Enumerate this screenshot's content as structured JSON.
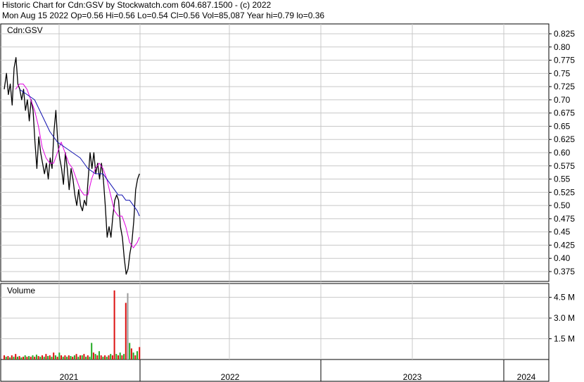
{
  "header": {
    "line1": "Historic Chart for Cdn:GSV by Stockwatch.com 604.687.1500 - (c) 2022",
    "line2": "Mon Aug 15 2022  Op=0.56  Hi=0.56  Lo=0.54  Cl=0.56  Vol=85,087  Year hi=0.79  lo=0.36"
  },
  "colors": {
    "price": "#000000",
    "ma_short": "#e000e0",
    "ma_long": "#1010b0",
    "vol_up": "#22aa22",
    "vol_down": "#dd1111",
    "vol_flat": "#999999",
    "grid": "#c8c8c8"
  },
  "chart_data": [
    {
      "type": "line",
      "title": "Cdn:GSV",
      "x_axis": {
        "labels": [
          "2021",
          "2022",
          "2023",
          "2024"
        ]
      },
      "y_axis": {
        "side": "right",
        "ylim": [
          0.34,
          0.84
        ],
        "ticks": [
          "0.825",
          "0.80",
          "0.775",
          "0.75",
          "0.725",
          "0.70",
          "0.675",
          "0.65",
          "0.625",
          "0.60",
          "0.575",
          "0.55",
          "0.525",
          "0.50",
          "0.475",
          "0.45",
          "0.425",
          "0.40",
          "0.375"
        ]
      },
      "grid": true,
      "series": [
        {
          "values": [
            [
              0.0,
              0.72
            ],
            [
              0.6,
              0.75
            ],
            [
              1.1,
              0.71
            ],
            [
              1.6,
              0.73
            ],
            [
              2.1,
              0.69
            ],
            [
              2.6,
              0.76
            ],
            [
              3.1,
              0.78
            ],
            [
              3.6,
              0.73
            ],
            [
              4.1,
              0.72
            ],
            [
              4.6,
              0.7
            ],
            [
              5.1,
              0.72
            ],
            [
              5.6,
              0.68
            ],
            [
              6.1,
              0.7
            ],
            [
              6.6,
              0.66
            ],
            [
              7.1,
              0.7
            ],
            [
              7.6,
              0.68
            ],
            [
              8.1,
              0.62
            ],
            [
              8.6,
              0.57
            ],
            [
              9.1,
              0.63
            ],
            [
              9.6,
              0.6
            ],
            [
              10.1,
              0.58
            ],
            [
              10.6,
              0.56
            ],
            [
              11.1,
              0.58
            ],
            [
              11.6,
              0.55
            ],
            [
              12.1,
              0.59
            ],
            [
              12.6,
              0.57
            ],
            [
              13.1,
              0.64
            ],
            [
              13.6,
              0.68
            ],
            [
              14.1,
              0.62
            ],
            [
              14.6,
              0.59
            ],
            [
              15.1,
              0.57
            ],
            [
              15.6,
              0.54
            ],
            [
              16.1,
              0.6
            ],
            [
              16.6,
              0.57
            ],
            [
              17.1,
              0.53
            ],
            [
              17.6,
              0.57
            ],
            [
              18.1,
              0.55
            ],
            [
              18.6,
              0.52
            ],
            [
              19.1,
              0.5
            ],
            [
              19.6,
              0.53
            ],
            [
              20.1,
              0.5
            ],
            [
              20.6,
              0.49
            ],
            [
              21.1,
              0.51
            ],
            [
              21.6,
              0.5
            ],
            [
              22.1,
              0.55
            ],
            [
              22.6,
              0.6
            ],
            [
              23.1,
              0.57
            ],
            [
              23.6,
              0.6
            ],
            [
              24.1,
              0.56
            ],
            [
              24.6,
              0.58
            ],
            [
              25.1,
              0.55
            ],
            [
              25.6,
              0.58
            ],
            [
              26.1,
              0.55
            ],
            [
              26.6,
              0.5
            ],
            [
              27.1,
              0.44
            ],
            [
              27.6,
              0.46
            ],
            [
              28.1,
              0.44
            ],
            [
              28.6,
              0.48
            ],
            [
              29.1,
              0.51
            ],
            [
              29.6,
              0.52
            ],
            [
              30.1,
              0.51
            ],
            [
              30.6,
              0.46
            ],
            [
              31.1,
              0.44
            ],
            [
              31.6,
              0.4
            ],
            [
              32.1,
              0.37
            ],
            [
              32.6,
              0.38
            ],
            [
              33.1,
              0.41
            ],
            [
              33.6,
              0.43
            ],
            [
              34.1,
              0.47
            ],
            [
              34.6,
              0.53
            ],
            [
              35.1,
              0.55
            ],
            [
              35.6,
              0.56
            ]
          ]
        },
        {
          "values": [
            [
              3.0,
              0.72
            ],
            [
              4.0,
              0.73
            ],
            [
              5.0,
              0.73
            ],
            [
              6.0,
              0.72
            ],
            [
              7.0,
              0.7
            ],
            [
              8.0,
              0.68
            ],
            [
              9.0,
              0.65
            ],
            [
              10.0,
              0.61
            ],
            [
              11.0,
              0.59
            ],
            [
              12.0,
              0.58
            ],
            [
              13.0,
              0.58
            ],
            [
              14.0,
              0.6
            ],
            [
              15.0,
              0.62
            ],
            [
              16.0,
              0.6
            ],
            [
              17.0,
              0.58
            ],
            [
              18.0,
              0.57
            ],
            [
              19.0,
              0.55
            ],
            [
              20.0,
              0.53
            ],
            [
              21.0,
              0.52
            ],
            [
              22.0,
              0.52
            ],
            [
              23.0,
              0.55
            ],
            [
              24.0,
              0.57
            ],
            [
              25.0,
              0.58
            ],
            [
              26.0,
              0.57
            ],
            [
              27.0,
              0.55
            ],
            [
              28.0,
              0.52
            ],
            [
              29.0,
              0.49
            ],
            [
              30.0,
              0.48
            ],
            [
              31.0,
              0.48
            ],
            [
              32.0,
              0.46
            ],
            [
              33.0,
              0.43
            ],
            [
              34.0,
              0.42
            ],
            [
              35.0,
              0.43
            ],
            [
              35.6,
              0.44
            ]
          ]
        },
        {
          "values": [
            [
              4.0,
              0.72
            ],
            [
              6.0,
              0.71
            ],
            [
              8.0,
              0.7
            ],
            [
              10.0,
              0.67
            ],
            [
              12.0,
              0.64
            ],
            [
              14.0,
              0.62
            ],
            [
              16.0,
              0.61
            ],
            [
              18.0,
              0.6
            ],
            [
              20.0,
              0.59
            ],
            [
              22.0,
              0.57
            ],
            [
              24.0,
              0.56
            ],
            [
              26.0,
              0.56
            ],
            [
              27.0,
              0.55
            ],
            [
              28.0,
              0.54
            ],
            [
              29.0,
              0.53
            ],
            [
              30.0,
              0.52
            ],
            [
              31.0,
              0.52
            ],
            [
              32.0,
              0.51
            ],
            [
              33.0,
              0.51
            ],
            [
              34.0,
              0.5
            ],
            [
              35.0,
              0.49
            ],
            [
              35.6,
              0.48
            ]
          ]
        }
      ]
    },
    {
      "type": "bar",
      "title": "Volume",
      "y_axis": {
        "side": "right",
        "ylim": [
          0,
          5.5
        ],
        "ticks": [
          "4.5 M",
          "3.0 M",
          "1.5 M"
        ]
      },
      "grid": true,
      "values": [
        [
          0.0,
          0.3,
          "r"
        ],
        [
          0.5,
          0.2,
          "g"
        ],
        [
          1.0,
          0.25,
          "r"
        ],
        [
          1.5,
          0.15,
          "g"
        ],
        [
          2.0,
          0.3,
          "r"
        ],
        [
          2.5,
          0.2,
          "g"
        ],
        [
          3.0,
          0.4,
          "r"
        ],
        [
          3.5,
          0.2,
          "g"
        ],
        [
          4.0,
          0.25,
          "r"
        ],
        [
          4.5,
          0.15,
          "g"
        ],
        [
          5.0,
          0.2,
          "r"
        ],
        [
          5.5,
          0.3,
          "g"
        ],
        [
          6.0,
          0.2,
          "r"
        ],
        [
          6.5,
          0.25,
          "g"
        ],
        [
          7.0,
          0.2,
          "r"
        ],
        [
          7.5,
          0.3,
          "g"
        ],
        [
          8.0,
          0.2,
          "r"
        ],
        [
          8.5,
          0.35,
          "g"
        ],
        [
          9.0,
          0.25,
          "r"
        ],
        [
          9.5,
          0.2,
          "g"
        ],
        [
          10.0,
          0.3,
          "r"
        ],
        [
          10.5,
          0.2,
          "g"
        ],
        [
          11.0,
          0.4,
          "r"
        ],
        [
          11.5,
          0.25,
          "g"
        ],
        [
          12.0,
          0.3,
          "r"
        ],
        [
          12.5,
          0.2,
          "g"
        ],
        [
          13.0,
          0.5,
          "r"
        ],
        [
          13.5,
          0.3,
          "g"
        ],
        [
          14.0,
          0.2,
          "r"
        ],
        [
          14.5,
          0.5,
          "g"
        ],
        [
          15.0,
          0.3,
          "r"
        ],
        [
          15.5,
          0.2,
          "g"
        ],
        [
          16.0,
          0.3,
          "r"
        ],
        [
          16.5,
          0.2,
          "g"
        ],
        [
          17.0,
          0.3,
          "r"
        ],
        [
          17.5,
          0.25,
          "g"
        ],
        [
          18.0,
          0.2,
          "r"
        ],
        [
          18.5,
          0.3,
          "g"
        ],
        [
          19.0,
          0.4,
          "r"
        ],
        [
          19.5,
          0.2,
          "g"
        ],
        [
          20.0,
          0.3,
          "r"
        ],
        [
          20.5,
          0.3,
          "g"
        ],
        [
          21.0,
          0.4,
          "r"
        ],
        [
          21.5,
          0.2,
          "g"
        ],
        [
          22.0,
          0.3,
          "r"
        ],
        [
          22.5,
          0.2,
          "g"
        ],
        [
          23.0,
          1.2,
          "g"
        ],
        [
          23.5,
          0.5,
          "r"
        ],
        [
          24.0,
          0.4,
          "g"
        ],
        [
          24.5,
          0.3,
          "r"
        ],
        [
          25.0,
          0.6,
          "g"
        ],
        [
          25.5,
          0.3,
          "r"
        ],
        [
          26.0,
          0.2,
          "g"
        ],
        [
          26.5,
          0.3,
          "r"
        ],
        [
          27.0,
          0.2,
          "g"
        ],
        [
          27.5,
          0.3,
          "r"
        ],
        [
          28.0,
          0.4,
          "g"
        ],
        [
          28.5,
          0.3,
          "r"
        ],
        [
          29.0,
          5.0,
          "r"
        ],
        [
          29.5,
          0.4,
          "g"
        ],
        [
          30.0,
          0.3,
          "r"
        ],
        [
          30.5,
          0.5,
          "g"
        ],
        [
          31.0,
          0.3,
          "r"
        ],
        [
          31.5,
          0.4,
          "g"
        ],
        [
          32.0,
          4.1,
          "r"
        ],
        [
          32.5,
          4.8,
          "f"
        ],
        [
          33.0,
          1.2,
          "g"
        ],
        [
          33.5,
          0.8,
          "r"
        ],
        [
          34.0,
          0.5,
          "g"
        ],
        [
          34.5,
          0.3,
          "r"
        ],
        [
          35.0,
          0.6,
          "g"
        ],
        [
          35.6,
          0.9,
          "r"
        ]
      ]
    }
  ]
}
